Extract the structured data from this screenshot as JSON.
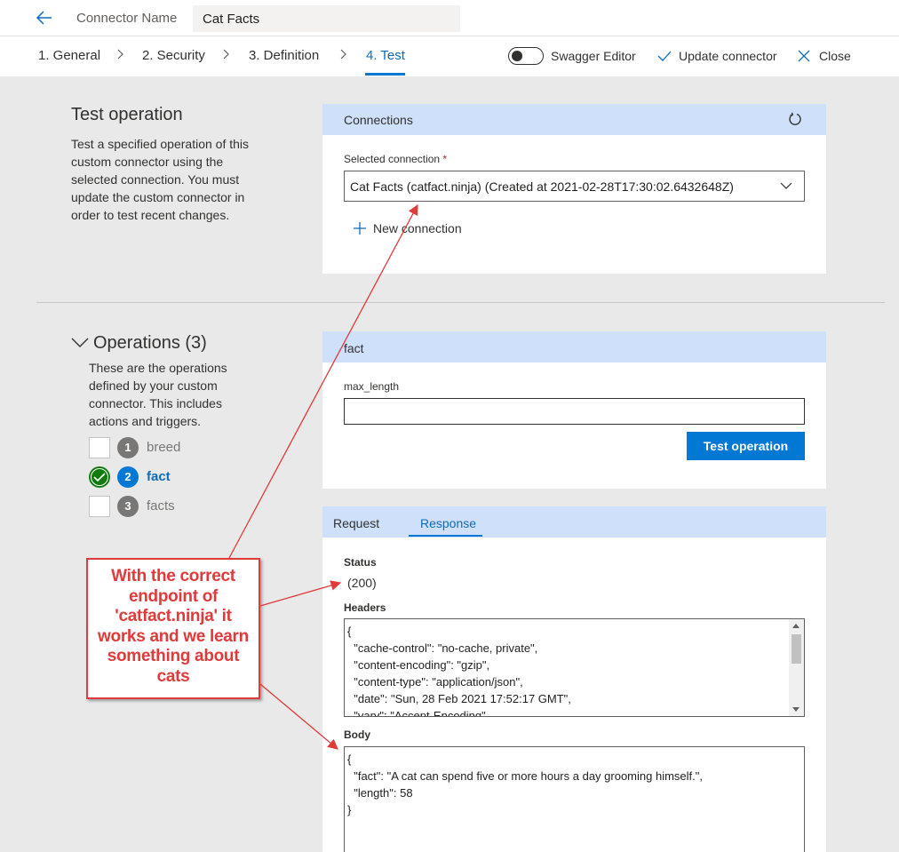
{
  "header": {
    "connector_name_label": "Connector Name",
    "connector_name_value": "Cat Facts"
  },
  "tabs": [
    {
      "label": "1. General"
    },
    {
      "label": "2. Security"
    },
    {
      "label": "3. Definition"
    },
    {
      "label": "4. Test",
      "active": true
    }
  ],
  "toolbar": {
    "swagger_label": "Swagger Editor",
    "swagger_enabled": false,
    "update_label": "Update connector",
    "close_label": "Close"
  },
  "test_operation": {
    "title": "Test operation",
    "description": "Test a specified operation of this custom connector using the selected connection. You must update the custom connector in order to test recent changes."
  },
  "connections": {
    "title": "Connections",
    "selected_label": "Selected connection",
    "required_mark": "*",
    "selected_value": "Cat Facts (catfact.ninja) (Created at 2021-02-28T17:30:02.6432648Z)",
    "new_connection_label": "New connection"
  },
  "operations": {
    "title": "Operations (3)",
    "description": "These are the operations defined by your custom connector. This includes actions and triggers.",
    "items": [
      {
        "num": "1",
        "label": "breed",
        "status": "none"
      },
      {
        "num": "2",
        "label": "fact",
        "status": "success",
        "active": true
      },
      {
        "num": "3",
        "label": "facts",
        "status": "none"
      }
    ]
  },
  "operation_panel": {
    "title": "fact",
    "param_label": "max_length",
    "param_value": "",
    "test_button_label": "Test operation"
  },
  "response": {
    "tab_request": "Request",
    "tab_response": "Response",
    "status_label": "Status",
    "status_value": "(200)",
    "headers_label": "Headers",
    "headers_text": "{\n  \"cache-control\": \"no-cache, private\",\n  \"content-encoding\": \"gzip\",\n  \"content-type\": \"application/json\",\n  \"date\": \"Sun, 28 Feb 2021 17:52:17 GMT\",\n  \"vary\": \"Accept-Encoding\"",
    "body_label": "Body",
    "body_text": "{\n  \"fact\": \"A cat can spend five or more hours a day grooming himself.\",\n  \"length\": 58\n}"
  },
  "annotation": {
    "text": "With the correct endpoint of 'catfact.ninja' it works and we learn something about cats",
    "color": "#e03a3a"
  },
  "colors": {
    "accent": "#0078d4",
    "card_header": "#cfe0fa",
    "success": "#107c10",
    "background": "#e9e9e9"
  }
}
